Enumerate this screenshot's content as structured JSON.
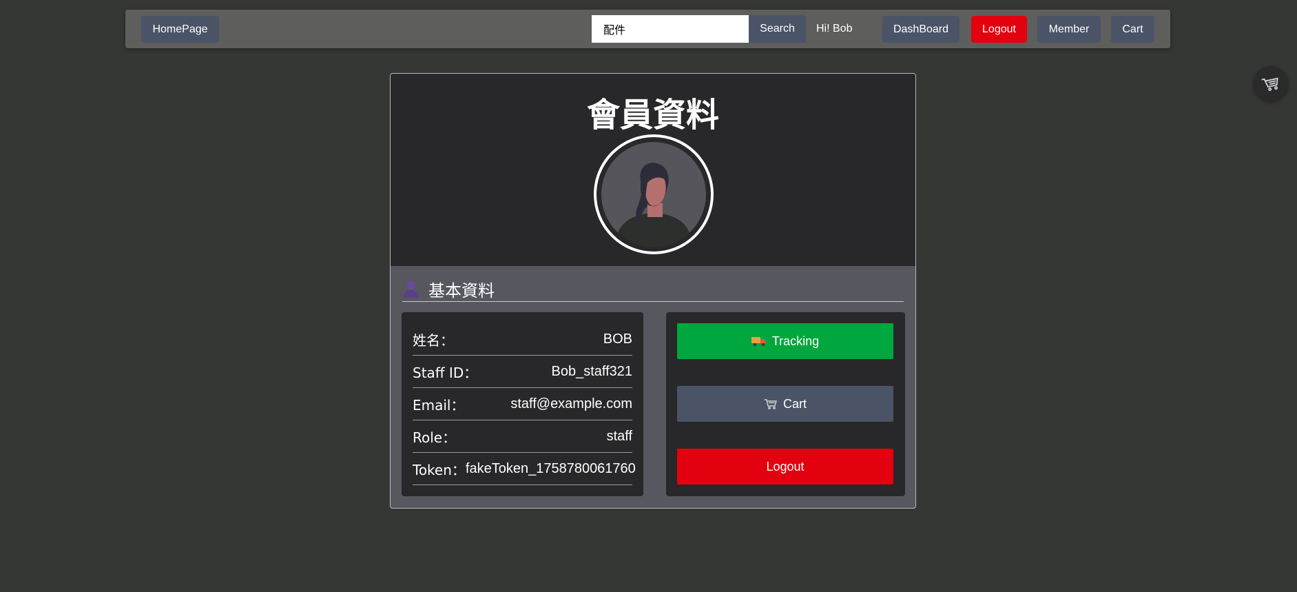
{
  "navbar": {
    "home_label": "HomePage",
    "search_value": "配件",
    "search_label": "Search",
    "greeting": "Hi! Bob",
    "dashboard_label": "DashBoard",
    "logout_label": "Logout",
    "member_label": "Member",
    "cart_label": "Cart"
  },
  "floating_cart": {
    "icon": "cart-icon"
  },
  "profile": {
    "title": "會員資料",
    "avatar_icon": "user-avatar-icon",
    "section_title": "基本資料",
    "section_icon": "person-icon",
    "fields": [
      {
        "label": "姓名：",
        "value": "BOB"
      },
      {
        "label": "Staff ID：",
        "value": "Bob_staff321"
      },
      {
        "label": "Email：",
        "value": "staff@example.com"
      },
      {
        "label": "Role：",
        "value": "staff"
      },
      {
        "label": "Token：",
        "value": "fakeToken_1758780061760"
      }
    ]
  },
  "actions": {
    "tracking_label": "Tracking",
    "tracking_icon": "truck-icon",
    "cart_label": "Cart",
    "cart_icon": "cart-icon",
    "logout_label": "Logout"
  },
  "colors": {
    "background": "#353734",
    "navbar": "#5e5e5d",
    "nav_button": "#4a5466",
    "danger": "#e3000f",
    "success": "#00a73e",
    "card_dark": "#28282a",
    "card_body": "#56575f"
  }
}
